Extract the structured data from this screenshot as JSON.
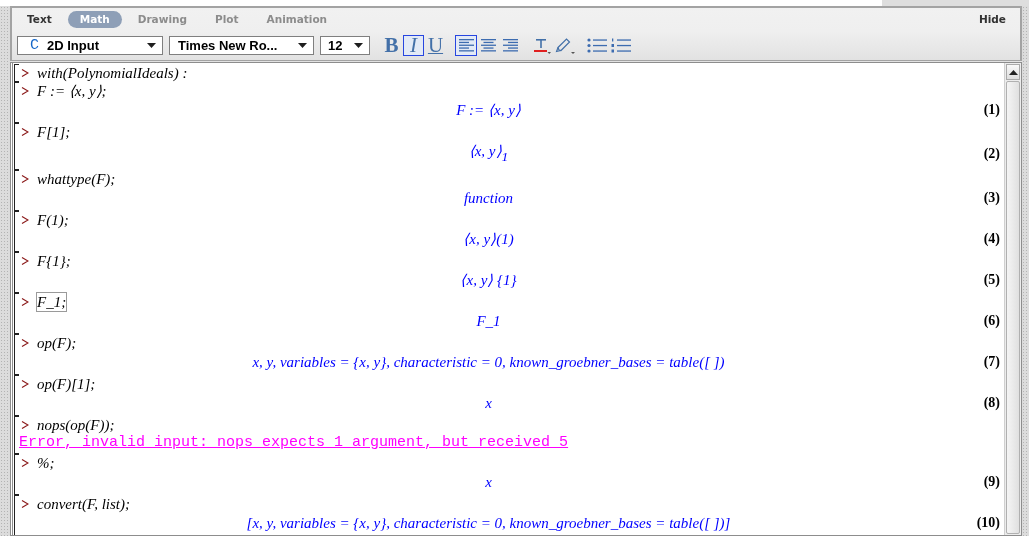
{
  "tabs": [
    {
      "label": "Text",
      "selected": false,
      "disabled": false
    },
    {
      "label": "Math",
      "selected": true,
      "disabled": false
    },
    {
      "label": "Drawing",
      "selected": false,
      "disabled": true
    },
    {
      "label": "Plot",
      "selected": false,
      "disabled": true
    },
    {
      "label": "Animation",
      "selected": false,
      "disabled": true
    }
  ],
  "hide_button": "Hide",
  "toolbar": {
    "input_mode": {
      "icon": "C",
      "value": "2D Input"
    },
    "font": {
      "value": "Times New Ro..."
    },
    "font_size": {
      "value": "12"
    },
    "style_buttons": [
      {
        "label": "B",
        "kind": "bold",
        "selected": false
      },
      {
        "label": "I",
        "kind": "italic",
        "selected": true
      },
      {
        "label": "U",
        "kind": "underline",
        "selected": false
      }
    ],
    "align_buttons": [
      {
        "kind": "left",
        "selected": true
      },
      {
        "kind": "center",
        "selected": false
      },
      {
        "kind": "right",
        "selected": false
      }
    ]
  },
  "groups": [
    {
      "input": "with(PolynomialIdeals) :",
      "active": false
    },
    {
      "input": "F := ⟨x, y⟩;",
      "output": "F := ⟨x, y⟩",
      "label": "(1)",
      "active": false
    },
    {
      "input": "F[1];",
      "output": "⟨x, y⟩$_{1}$",
      "label": "(2)",
      "active": false
    },
    {
      "input": "whattype(F);",
      "output": "function",
      "label": "(3)",
      "active": false
    },
    {
      "input": "F(1);",
      "output": "⟨x, y⟩(1)",
      "label": "(4)",
      "active": false
    },
    {
      "input": "F{1};",
      "output": "⟨x, y⟩ {1}",
      "label": "(5)",
      "active": false
    },
    {
      "input": "F_1;",
      "output": "F_1",
      "label": "(6)",
      "active": true
    },
    {
      "input": "op(F);",
      "output": "x, y, variables = {x, y}, characteristic = 0, known_groebner_bases = table([ ])",
      "label": "(7)",
      "active": false
    },
    {
      "input": "op(F)[1];",
      "output": "x",
      "label": "(8)",
      "active": false
    },
    {
      "input": "nops(op(F));",
      "error": "Error, invalid input: nops expects 1 argument, but received 5",
      "active": false
    },
    {
      "input": "%;",
      "output": "x",
      "label": "(9)",
      "active": false
    },
    {
      "input": "convert(F, list);",
      "output": "[x, y, variables = {x, y}, characteristic = 0, known_groebner_bases = table([ ])]",
      "label": "(10)",
      "active": false
    }
  ]
}
